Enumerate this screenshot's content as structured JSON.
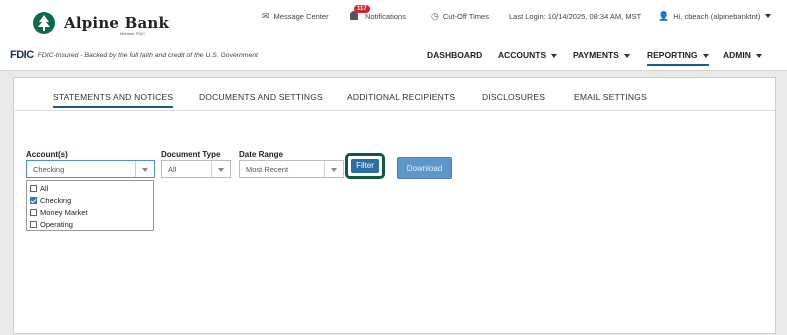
{
  "brand": {
    "name": "Alpine Bank",
    "sub": "Member FDIC"
  },
  "utility": {
    "message_center": "Message Center",
    "notifications_count": "117",
    "notifications": "Notifications",
    "cutoff_times": "Cut-Off Times",
    "last_login": "Last Login: 10/14/2025, 08:34 AM, MST",
    "user": "Hi, cbeach (alpinebanktnt)"
  },
  "fdic": {
    "logo": "FDIC",
    "text": "FDIC-Insured - Backed by the full faith and credit of the U.S. Government"
  },
  "nav": {
    "dashboard": "DASHBOARD",
    "accounts": "ACCOUNTS",
    "payments": "PAYMENTS",
    "reporting": "REPORTING",
    "admin": "ADMIN"
  },
  "tabs": {
    "statements": "STATEMENTS AND NOTICES",
    "documents": "DOCUMENTS AND SETTINGS",
    "recipients": "ADDITIONAL RECIPIENTS",
    "disclosures": "DISCLOSURES",
    "email": "EMAIL SETTINGS"
  },
  "filters": {
    "accounts_label": "Account(s)",
    "accounts_value": "Checking",
    "doctype_label": "Document Type",
    "doctype_value": "All",
    "daterange_label": "Date Range",
    "daterange_value": "Most Recent",
    "filter_button": "Filter",
    "download_button": "Download"
  },
  "account_options": [
    {
      "label": "All",
      "checked": false
    },
    {
      "label": "Checking",
      "checked": true
    },
    {
      "label": "Money Market",
      "checked": false
    },
    {
      "label": "Operating",
      "checked": false
    }
  ],
  "colors": {
    "brand_green": "#0e6a47",
    "primary_blue": "#2a6fa5",
    "focus_ring": "#0f5a3e"
  }
}
